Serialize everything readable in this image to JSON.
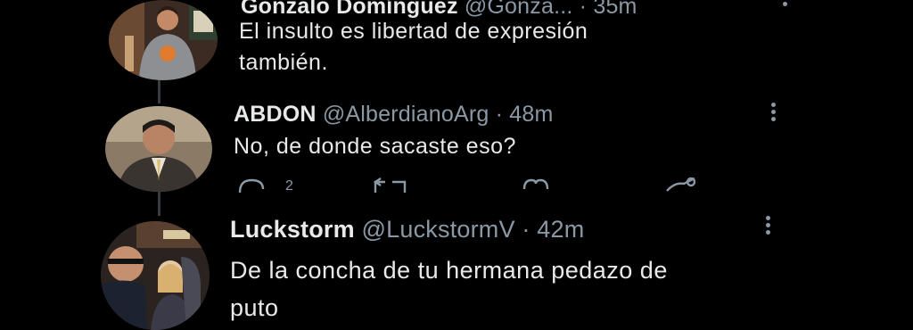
{
  "tweets": [
    {
      "display_name": "Gonzalo Domínguez",
      "handle": "@Gonza...",
      "time": "· 35m",
      "text_lines": [
        "El insulto es libertad de expresión",
        "también."
      ]
    },
    {
      "display_name": "ABDON",
      "handle": "@AlberdianoArg",
      "time": "· 48m",
      "text_lines": [
        "No, de donde sacaste eso?"
      ],
      "reply_count": "2"
    },
    {
      "display_name": "Luckstorm",
      "handle": "@LuckstormV",
      "time": "· 42m",
      "text_lines": [
        "De la concha de tu hermana pedazo de",
        "puto"
      ]
    }
  ],
  "colors": {
    "background": "#000000",
    "text": "#e7e9ea",
    "meta": "#8b98a5",
    "thread": "#3a3d40"
  },
  "icons": [
    "more-icon",
    "reply-icon",
    "retweet-icon",
    "like-icon",
    "share-icon"
  ]
}
